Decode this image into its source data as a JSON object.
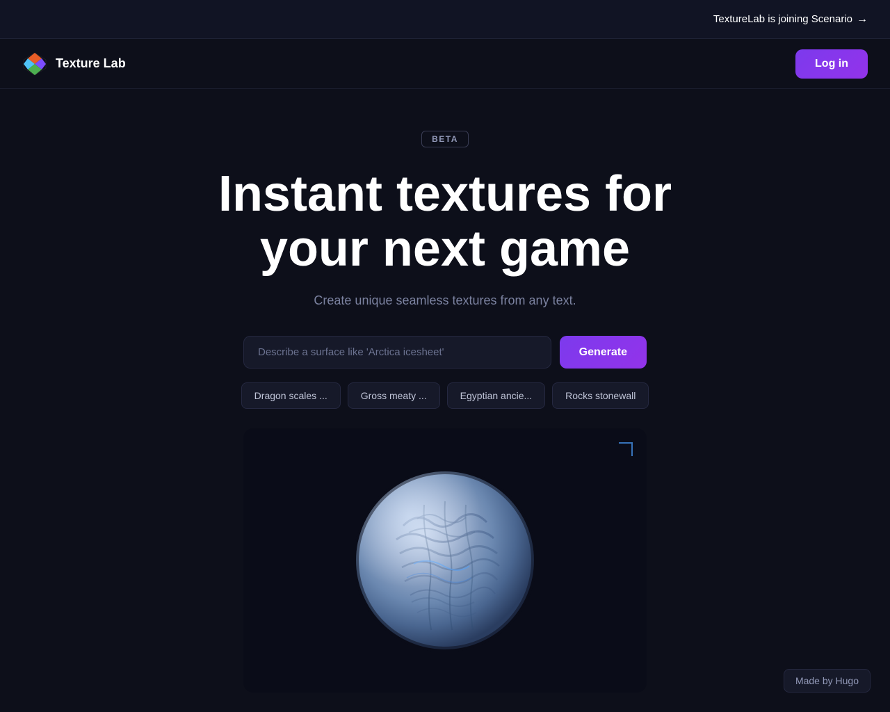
{
  "announcement": {
    "text": "TextureLab is joining Scenario",
    "arrow": "→"
  },
  "nav": {
    "logo_text": "Texture Lab",
    "login_label": "Log in"
  },
  "hero": {
    "beta_label": "BETA",
    "title_line1": "Instant textures for",
    "title_line2": "your next game",
    "subtitle": "Create unique seamless textures from any text.",
    "input_placeholder": "Describe a surface like 'Arctica icesheet'",
    "generate_label": "Generate"
  },
  "suggestions": [
    {
      "label": "Dragon scales ..."
    },
    {
      "label": "Gross meaty ..."
    },
    {
      "label": "Egyptian ancie..."
    },
    {
      "label": "Rocks stonewall"
    }
  ],
  "footer": {
    "made_by": "Made by Hugo"
  }
}
